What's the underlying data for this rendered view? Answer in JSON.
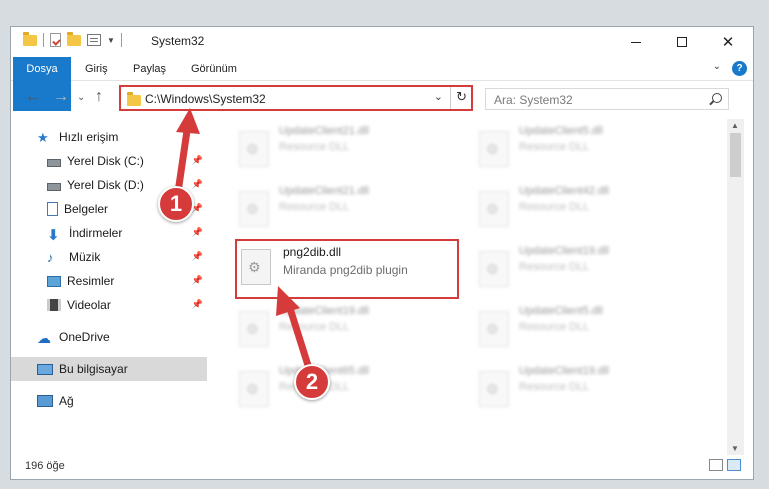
{
  "window": {
    "title": "System32",
    "controls": {
      "minimize": "—",
      "maximize": "☐",
      "close": "✕"
    }
  },
  "ribbon": {
    "tabs": [
      "Dosya",
      "Giriş",
      "Paylaş",
      "Görünüm"
    ],
    "help": "?"
  },
  "nav": {
    "back": "←",
    "forward": "→",
    "recent": "⌄",
    "up": "↑",
    "address": "C:\\Windows\\System32",
    "search_placeholder": "Ara: System32"
  },
  "sidebar": {
    "items": [
      {
        "label": "Hızlı erişim",
        "icon": "star-icon"
      },
      {
        "label": "Yerel Disk (C:)",
        "icon": "drive-icon",
        "pinned": true
      },
      {
        "label": "Yerel Disk (D:)",
        "icon": "drive-icon",
        "pinned": true
      },
      {
        "label": "Belgeler",
        "icon": "documents-icon",
        "pinned": true
      },
      {
        "label": "İndirmeler",
        "icon": "downloads-icon",
        "pinned": true
      },
      {
        "label": "Müzik",
        "icon": "music-icon",
        "pinned": true
      },
      {
        "label": "Resimler",
        "icon": "pictures-icon",
        "pinned": true
      },
      {
        "label": "Videolar",
        "icon": "videos-icon",
        "pinned": true
      },
      {
        "label": "OneDrive",
        "icon": "onedrive-icon"
      },
      {
        "label": "Bu bilgisayar",
        "icon": "computer-icon",
        "selected": true
      },
      {
        "label": "Ağ",
        "icon": "network-icon"
      }
    ]
  },
  "files": [
    {
      "name": "UpdateClient21.dll",
      "desc": "Resource DLL"
    },
    {
      "name": "UpdateClient5.dll",
      "desc": "Resource DLL"
    },
    {
      "name": "UpdateClient21.dll",
      "desc": "Resource DLL"
    },
    {
      "name": "UpdateClient42.dll",
      "desc": "Resource DLL"
    },
    {
      "name": "png2dib.dll",
      "desc": "Miranda png2dib plugin"
    },
    {
      "name": "UpdateClient19.dll",
      "desc": "Resource DLL"
    },
    {
      "name": "UpdateClient19.dll",
      "desc": "Resource DLL"
    },
    {
      "name": "UpdateClient5.dll",
      "desc": "Resource DLL"
    },
    {
      "name": "UpdateClient65.dll",
      "desc": "Resource DLL"
    },
    {
      "name": "UpdateClient19.dll",
      "desc": "Resource DLL"
    }
  ],
  "status": {
    "count": "196 öğe"
  },
  "annotations": {
    "step1": "1",
    "step2": "2",
    "color": "#d63b3b"
  }
}
